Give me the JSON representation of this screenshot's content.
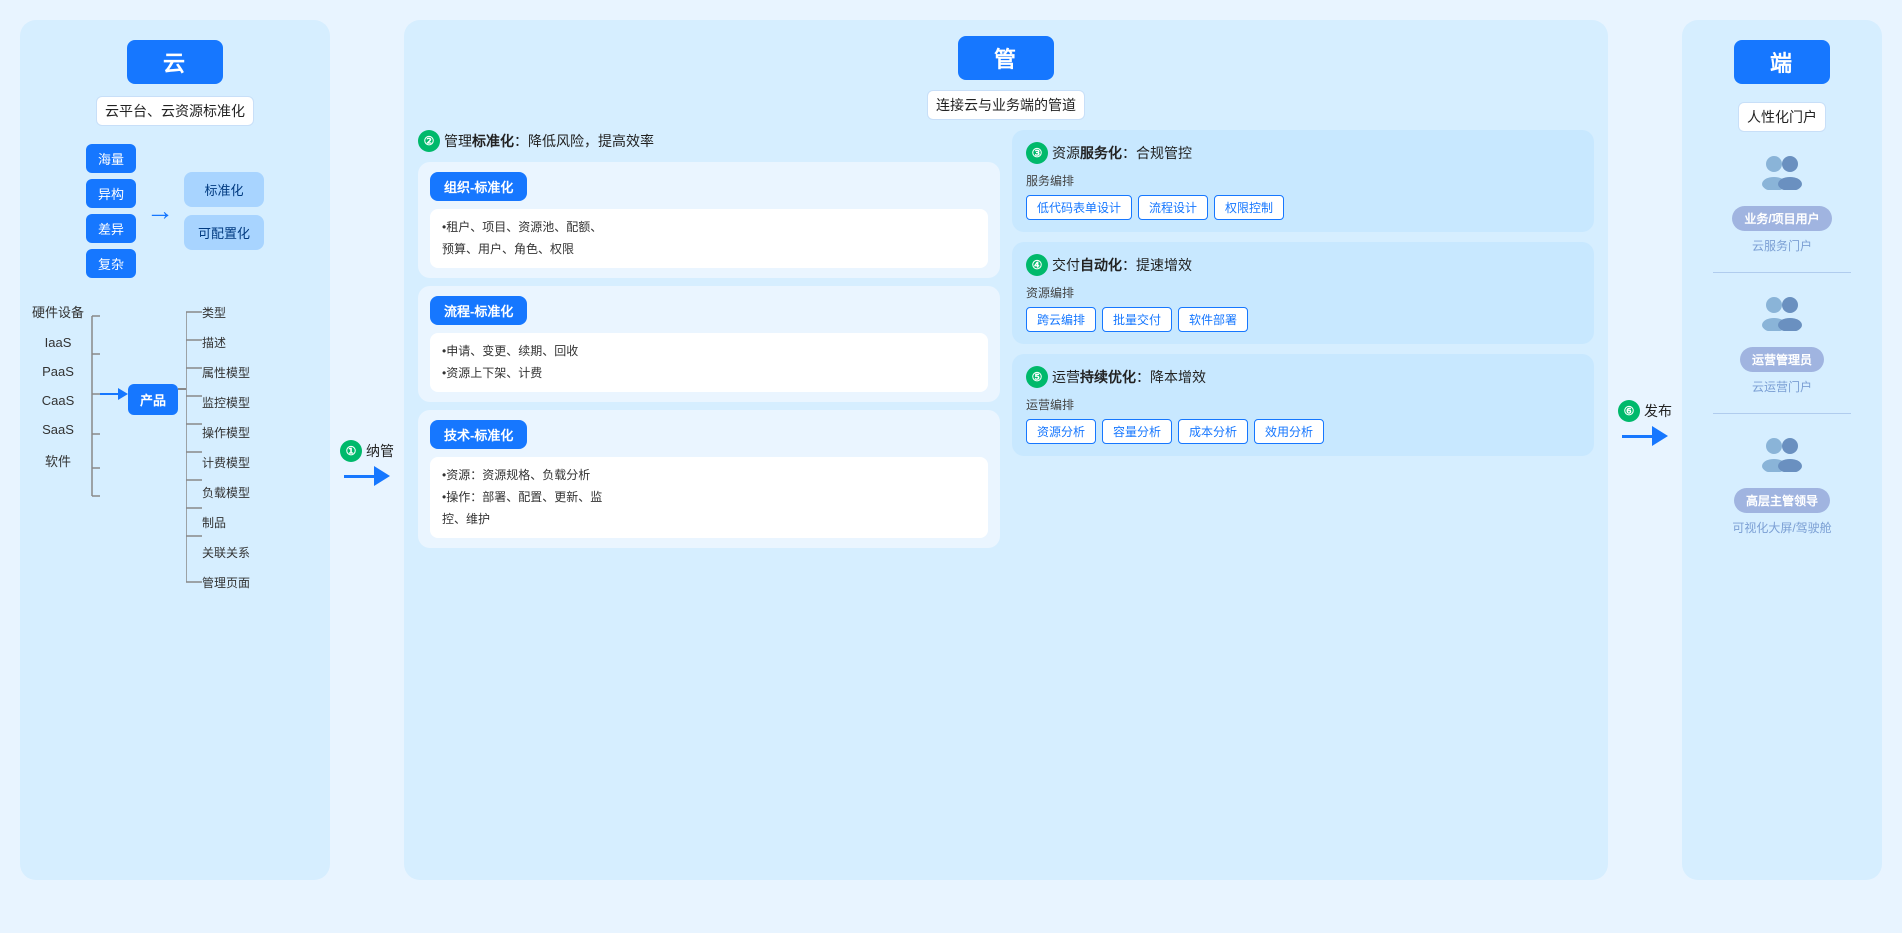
{
  "cloud": {
    "title": "云",
    "subtitle": "云平台、云资源标准化",
    "tags_left": [
      "海量",
      "异构",
      "差异",
      "复杂"
    ],
    "arrow": "→",
    "tags_right": [
      "标准化",
      "可配置化"
    ],
    "categories": [
      "硬件设备",
      "IaaS",
      "PaaS",
      "CaaS",
      "SaaS",
      "软件"
    ],
    "product_label": "产品",
    "product_attrs": [
      "类型",
      "描述",
      "属性模型",
      "监控模型",
      "操作模型",
      "计费模型",
      "负载模型",
      "制品",
      "关联关系",
      "管理页面"
    ]
  },
  "step1": {
    "num": "①",
    "label": "纳管"
  },
  "guan": {
    "title": "管",
    "subtitle": "连接云与业务端的管道",
    "step2": {
      "num": "②",
      "label": "管理",
      "bold": "标准化",
      "suffix": "：降低风险，提高效率",
      "sub_panels": [
        {
          "title": "组织-标准化",
          "content": "•租户、项目、资源池、配额、\n预算、用户、角色、权限"
        },
        {
          "title": "流程-标准化",
          "content": "•申请、变更、续期、回收\n•资源上下架、计费"
        },
        {
          "title": "技术-标准化",
          "content": "•资源：资源规格、负载分析\n•操作：部署、配置、更新、监\n控、维护"
        }
      ]
    },
    "step3": {
      "num": "③",
      "label": "资源",
      "bold": "服务化",
      "suffix": "：合规管控",
      "sub_label": "服务编排",
      "tags": [
        "低代码表单设计",
        "流程设计",
        "权限控制"
      ]
    },
    "step4": {
      "num": "④",
      "label": "交付",
      "bold": "自动化",
      "suffix": "：提速增效",
      "sub_label": "资源编排",
      "tags": [
        "跨云编排",
        "批量交付",
        "软件部署"
      ]
    },
    "step5": {
      "num": "⑤",
      "label": "运营",
      "bold": "持续优化",
      "suffix": "：降本增效",
      "sub_label": "运营编排",
      "tags": [
        "资源分析",
        "容量分析",
        "成本分析",
        "效用分析"
      ]
    }
  },
  "step6": {
    "num": "⑥",
    "label": "发布"
  },
  "duan": {
    "title": "端",
    "subtitle": "人性化门户",
    "users": [
      {
        "icon": "👥",
        "role": "业务/项目用户",
        "portal": "云服务门户"
      },
      {
        "icon": "👥",
        "role": "运营管理员",
        "portal": "云运营门户"
      },
      {
        "icon": "👥",
        "role": "高层主管领导",
        "portal": "可视化大屏/驾驶舱"
      }
    ]
  },
  "colors": {
    "primary_blue": "#1677ff",
    "light_blue_bg": "#d6eeff",
    "green": "#00b96b",
    "purple": "#8a6bbf",
    "tag_blue_border": "#1677ff"
  }
}
